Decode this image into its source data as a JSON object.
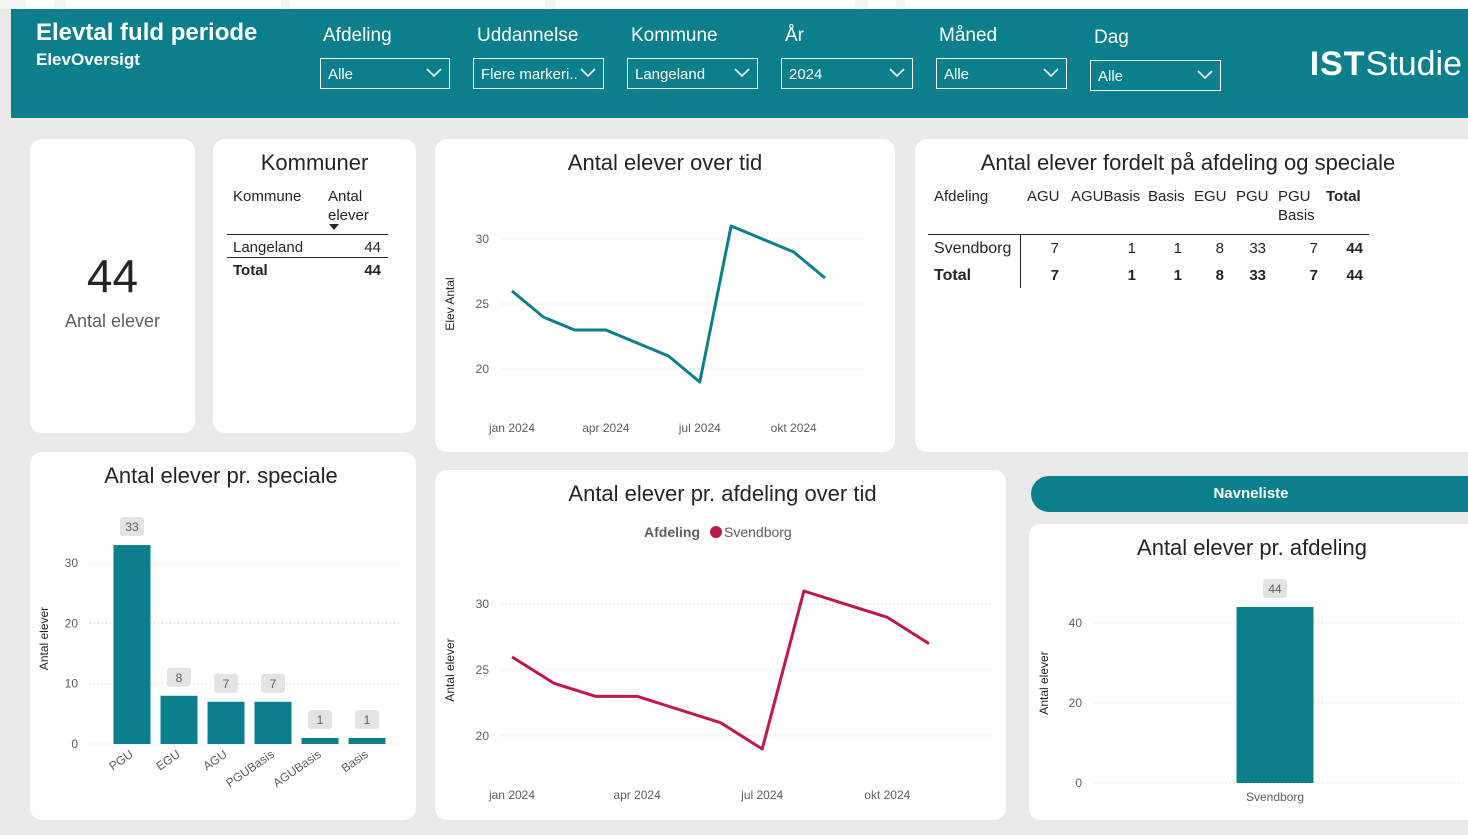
{
  "header": {
    "title": "Elevtal fuld periode",
    "subtitle": "ElevOversigt",
    "brand_bold": "IST",
    "brand_rest": "Studie",
    "slicers": [
      {
        "label": "Afdeling",
        "value": "Alle"
      },
      {
        "label": "Uddannelse",
        "value": "Flere markeri..."
      },
      {
        "label": "Kommune",
        "value": "Langeland"
      },
      {
        "label": "År",
        "value": "2024"
      },
      {
        "label": "Måned",
        "value": "Alle"
      },
      {
        "label": "Dag",
        "value": "Alle"
      }
    ]
  },
  "kpi": {
    "value": "44",
    "label": "Antal elever"
  },
  "kommuner": {
    "title": "Kommuner",
    "col1": "Kommune",
    "col2_line1": "Antal",
    "col2_line2": "elever",
    "rows": [
      {
        "name": "Langeland",
        "value": "44"
      }
    ],
    "total_label": "Total",
    "total_value": "44"
  },
  "matrix": {
    "title": "Antal elever fordelt på afdeling og speciale",
    "row_header": "Afdeling",
    "columns": [
      "AGU",
      "AGUBasis",
      "Basis",
      "EGU",
      "PGU",
      "PGU Basis",
      "Total"
    ],
    "pgu_basis_line1": "PGU",
    "pgu_basis_line2": "Basis",
    "rows": [
      {
        "name": "Svendborg",
        "values": [
          "7",
          "1",
          "1",
          "8",
          "33",
          "7",
          "44"
        ]
      },
      {
        "name": "Total",
        "values": [
          "7",
          "1",
          "1",
          "8",
          "33",
          "7",
          "44"
        ]
      }
    ]
  },
  "navbutton": {
    "label": "Navneliste"
  },
  "colors": {
    "teal": "#0b7f8c",
    "crimson": "#c0174a"
  },
  "chart_data": [
    {
      "id": "over_tid",
      "type": "line",
      "title": "Antal elever over tid",
      "xlabel": "",
      "ylabel": "Elev Antal",
      "x": [
        "2024-01",
        "2024-02",
        "2024-03",
        "2024-04",
        "2024-05",
        "2024-06",
        "2024-07",
        "2024-08",
        "2024-09",
        "2024-10",
        "2024-11"
      ],
      "x_ticks": [
        "jan 2024",
        "apr 2024",
        "jul 2024",
        "okt 2024"
      ],
      "y_ticks": [
        20,
        25,
        30
      ],
      "ylim": [
        19,
        31
      ],
      "series": [
        {
          "values": [
            26,
            24,
            23,
            23,
            22,
            21,
            19,
            31,
            30,
            29,
            27
          ]
        }
      ],
      "color": "#0b7f8c",
      "grid": true
    },
    {
      "id": "speciale",
      "type": "bar",
      "title": "Antal elever pr. speciale",
      "xlabel": "",
      "ylabel": "Antal elever",
      "categories": [
        "PGU",
        "EGU",
        "AGU",
        "PGUBasis",
        "AGUBasis",
        "Basis"
      ],
      "values": [
        33,
        8,
        7,
        7,
        1,
        1
      ],
      "y_ticks": [
        0,
        10,
        20,
        30
      ],
      "ylim": [
        0,
        35
      ],
      "color": "#0b7f8c",
      "grid": true
    },
    {
      "id": "afdeling_tid",
      "type": "line",
      "title": "Antal elever pr. afdeling over tid",
      "legend_title": "Afdeling",
      "xlabel": "",
      "ylabel": "Antal elever",
      "x": [
        "2024-01",
        "2024-02",
        "2024-03",
        "2024-04",
        "2024-05",
        "2024-06",
        "2024-07",
        "2024-08",
        "2024-09",
        "2024-10",
        "2024-11"
      ],
      "x_ticks": [
        "jan 2024",
        "apr 2024",
        "jul 2024",
        "okt 2024"
      ],
      "y_ticks": [
        20,
        25,
        30
      ],
      "ylim": [
        19,
        31
      ],
      "series": [
        {
          "name": "Svendborg",
          "values": [
            26,
            24,
            23,
            23,
            22,
            21,
            19,
            31,
            30,
            29,
            27
          ]
        }
      ],
      "color": "#c0174a",
      "legend": "top-center",
      "grid": true
    },
    {
      "id": "afdeling",
      "type": "bar",
      "title": "Antal elever pr. afdeling",
      "xlabel": "",
      "ylabel": "Antal elever",
      "categories": [
        "Svendborg"
      ],
      "values": [
        44
      ],
      "y_ticks": [
        0,
        20,
        40
      ],
      "ylim": [
        0,
        50
      ],
      "color": "#0b7f8c",
      "grid": true
    }
  ]
}
